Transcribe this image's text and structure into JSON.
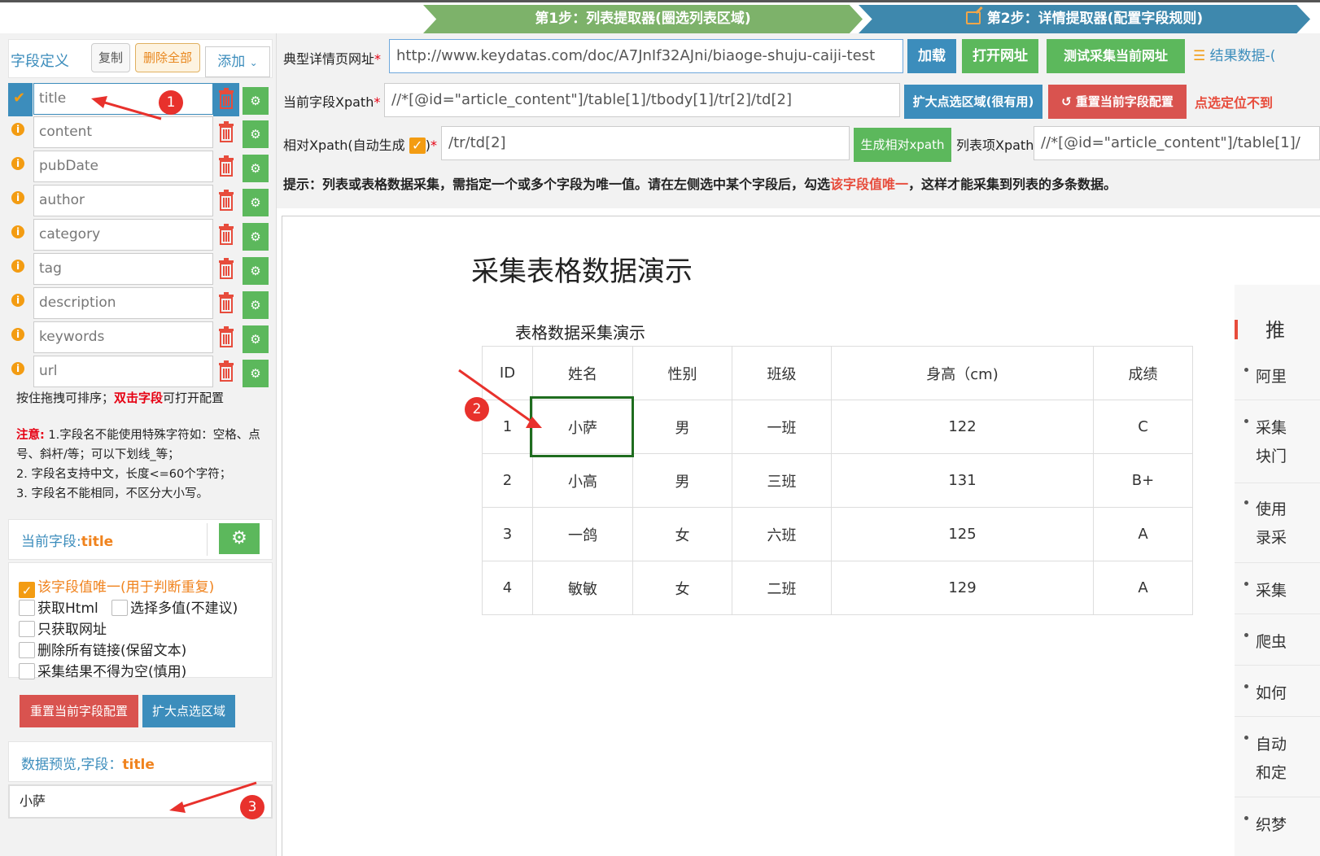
{
  "steps": {
    "step1": "第1步：列表提取器(圈选列表区域)",
    "step2": "第2步：详情提取器(配置字段规则)"
  },
  "left": {
    "title": "字段定义",
    "copy": "复制",
    "delete_all": "删除全部",
    "add": "添加",
    "fields": [
      "title",
      "content",
      "pubDate",
      "author",
      "category",
      "tag",
      "description",
      "keywords",
      "url"
    ],
    "hint_a": "按住拖拽可排序；",
    "hint_b": "双击字段",
    "hint_c": "可打开配置",
    "note_label": "注意:",
    "note_1": " 1.字段名不能使用特殊字符如：空格、点号、斜杆/等；可以下划线_等；",
    "note_2": "2. 字段名支持中文，长度<=60个字符；",
    "note_3": "3. 字段名不能相同，不区分大小写。",
    "current_label": "当前字段:",
    "current_name": "title",
    "opt_unique": "该字段值唯一(用于判断重复)",
    "opt_html": "获取Html",
    "opt_multi": "选择多值(不建议)",
    "opt_url": "只获取网址",
    "opt_links": "删除所有链接(保留文本)",
    "opt_notempty": "采集结果不得为空(慎用)",
    "btn_reset": "重置当前字段配置",
    "btn_expand": "扩大点选区域",
    "preview_label": "数据预览,字段：",
    "preview_field": "title",
    "preview_value": "小萨"
  },
  "config": {
    "url_label": "典型详情页网址",
    "url_value": "http://www.keydatas.com/doc/A7JnIf32AJni/biaoge-shuju-caiji-test",
    "btn_load": "加载",
    "btn_open": "打开网址",
    "btn_test": "测试采集当前网址",
    "btn_result": "结果数据-(",
    "xpath_label": "当前字段Xpath",
    "xpath_value": "//*[@id=\"article_content\"]/table[1]/tbody[1]/tr[2]/td[2]",
    "btn_expand": "扩大点选区域(很有用)",
    "btn_reset": "重置当前字段配置",
    "warn": "点选定位不到",
    "rel_label_a": "相对Xpath(自动生成",
    "rel_label_b": ")",
    "rel_value": "/tr/td[2]",
    "btn_gen": "生成相对xpath",
    "list_label": "列表项Xpath",
    "list_value": "//*[@id=\"article_content\"]/table[1]/",
    "tip_a": "提示：列表或表格数据采集，需指定一个或多个字段为唯一值。请在左侧选中某个字段后，勾选",
    "tip_b": "该字段值唯一",
    "tip_c": "，这样才能采集到列表的多条数据。"
  },
  "page": {
    "title": "采集表格数据演示",
    "subtitle": "表格数据采集演示",
    "headers": [
      "ID",
      "姓名",
      "性别",
      "班级",
      "身高（cm)",
      "成绩"
    ],
    "rows": [
      [
        "1",
        "小萨",
        "男",
        "一班",
        "122",
        "C"
      ],
      [
        "2",
        "小高",
        "男",
        "三班",
        "131",
        "B+"
      ],
      [
        "3",
        "一鸽",
        "女",
        "六班",
        "125",
        "A"
      ],
      [
        "4",
        "敏敏",
        "女",
        "二班",
        "129",
        "A"
      ]
    ],
    "side_head": "推",
    "side_items": [
      "阿里",
      "采集",
      "块门",
      "使用",
      "录采",
      "采集",
      "爬虫",
      "如何",
      "自动",
      "和定",
      "织梦"
    ]
  },
  "badges": [
    "1",
    "2",
    "3"
  ],
  "colors": {
    "green": "#5cb85c",
    "blue": "#3c8dbc",
    "orange": "#f39c12",
    "red": "#d9534f"
  }
}
